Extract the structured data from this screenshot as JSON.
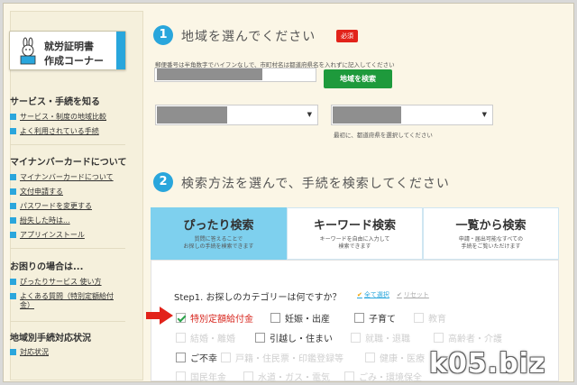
{
  "sidebar": {
    "banner": {
      "line1": "就労証明書",
      "line2": "作成コーナー"
    },
    "sections": [
      {
        "heading": "サービス・手続を知る",
        "links": [
          "サービス・制度の地域比較",
          "よく利用されている手続"
        ]
      },
      {
        "heading": "マイナンバーカードについて",
        "links": [
          "マイナンバーカードについて",
          "文付申請する",
          "パスワードを変更する",
          "紛失した時は...",
          "アプリインストール"
        ]
      },
      {
        "heading": "お困りの場合は...",
        "links": [
          "ぴったりサービス 使い方",
          "よくある質問（特別定額給付",
          "金）"
        ]
      },
      {
        "heading": "地域別手続対応状況",
        "links": [
          "対応状況"
        ]
      }
    ]
  },
  "step1": {
    "number": "1",
    "title": "地域を選んでください",
    "required_badge": "必須",
    "hint": "郵便番号は半角数字でハイフンなしで、市町村名は都道府県名を入れずに記入してください",
    "search_button": "地域を検索",
    "select_hint": "最初に、都道府県を選択してください"
  },
  "step2": {
    "number": "2",
    "title": "検索方法を選んで、手続を検索してください",
    "tabs": [
      {
        "label": "ぴったり検索",
        "sub1": "質問に答えることで",
        "sub2": "お探しの手続を検索できます"
      },
      {
        "label": "キーワード検索",
        "sub1": "キーワードを自由に入力して",
        "sub2": "検索できます"
      },
      {
        "label": "一覧から検索",
        "sub1": "申請・届出可能なすべての",
        "sub2": "手続をご覧いただけます"
      }
    ],
    "question": "Step1. お探しのカテゴリーは何ですか？",
    "check_all": "全て選択",
    "reset": "リセット",
    "options": [
      {
        "label": "特別定額給付金",
        "state": "selected"
      },
      {
        "label": "妊娠・出産",
        "state": "normal"
      },
      {
        "label": "子育て",
        "state": "normal"
      },
      {
        "label": "教育",
        "state": "dim"
      },
      {
        "label": "結婚・離婚",
        "state": "dim"
      },
      {
        "label": "引越し・住まい",
        "state": "normal"
      },
      {
        "label": "就職・退職",
        "state": "dim"
      },
      {
        "label": "高齢者・介護",
        "state": "dim"
      },
      {
        "label": "ご不幸",
        "state": "normal"
      },
      {
        "label": "戸籍・住民票・印鑑登録等",
        "state": "dim"
      },
      {
        "label": "健康・医療",
        "state": "dim"
      },
      {
        "label": "国民年金",
        "state": "dim"
      },
      {
        "label": "水道・ガス・電気",
        "state": "dim"
      },
      {
        "label": "ごみ・環境保全",
        "state": "dim"
      }
    ]
  },
  "watermark": "k05.biz",
  "colors": {
    "accent": "#29a6dc",
    "active_tab": "#7ed0ee",
    "required": "#e2231a",
    "search_green": "#1e9a3c",
    "selected_text": "#d7261e"
  }
}
